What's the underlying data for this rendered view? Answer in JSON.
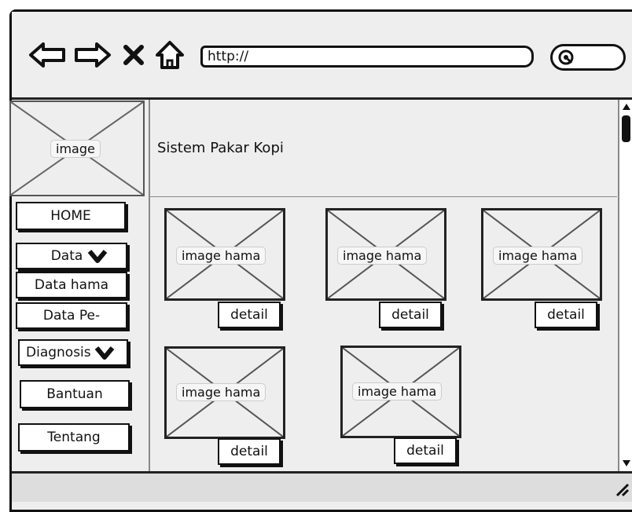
{
  "browser": {
    "url": "http://",
    "icons": [
      "back-arrow-icon",
      "forward-arrow-icon",
      "close-x-icon",
      "home-icon",
      "search-icon"
    ]
  },
  "sidebar": {
    "logo_placeholder": "image",
    "items": [
      {
        "label": "HOME",
        "icon": ""
      },
      {
        "label": "Data",
        "icon": "chevron-down-icon"
      },
      {
        "label": "Data hama",
        "icon": ""
      },
      {
        "label": "Data Pe-",
        "icon": ""
      },
      {
        "label": "Diagnosis",
        "icon": "chevron-down-icon"
      },
      {
        "label": "Bantuan",
        "icon": ""
      },
      {
        "label": "Tentang",
        "icon": ""
      }
    ]
  },
  "header": {
    "title": "Sistem Pakar Kopi"
  },
  "main": {
    "cards": [
      {
        "image_label": "image hama",
        "button_label": "detail"
      },
      {
        "image_label": "image hama",
        "button_label": "detail"
      },
      {
        "image_label": "image hama",
        "button_label": "detail"
      },
      {
        "image_label": "image hama",
        "button_label": "detail"
      },
      {
        "image_label": "image hama",
        "button_label": "detail"
      }
    ]
  },
  "colors": {
    "background": "#eeeeee",
    "border": "#111111",
    "button_fill": "#ffffff"
  }
}
